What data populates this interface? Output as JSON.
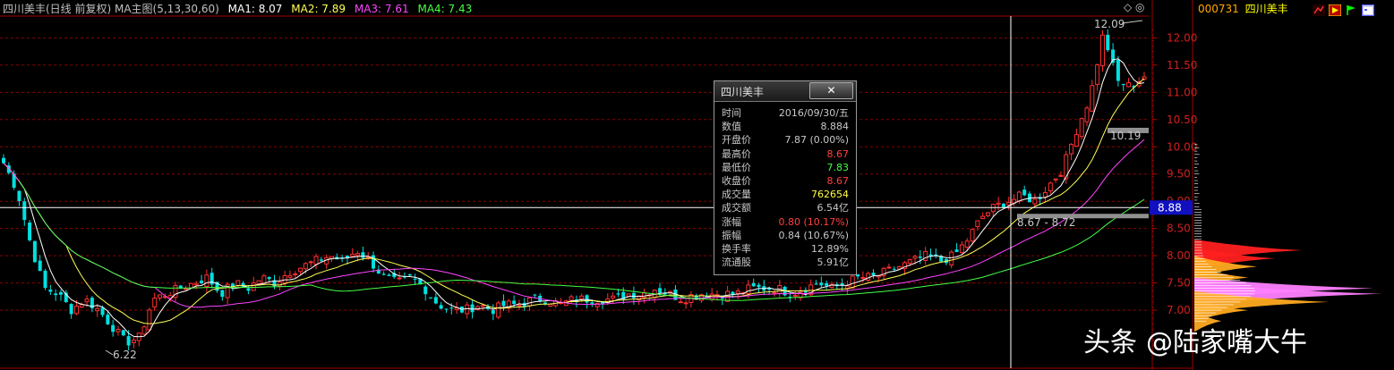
{
  "header": {
    "title": "四川美丰(日线 前复权) MA主图(5,13,30,60)",
    "ma": [
      {
        "label": "MA1: 8.07",
        "color": "#ffffff"
      },
      {
        "label": "MA2: 7.89",
        "color": "#ffff55"
      },
      {
        "label": "MA3: 7.61",
        "color": "#ff44ff"
      },
      {
        "label": "MA4: 7.43",
        "color": "#44ff44"
      }
    ]
  },
  "sidebar": {
    "code": "000731",
    "name": "四川美丰"
  },
  "price_axis": {
    "ticks": [
      "12.00",
      "11.50",
      "11.00",
      "10.50",
      "10.00",
      "9.50",
      "9.00",
      "8.50",
      "8.00",
      "7.50",
      "7.00"
    ],
    "current_label": "8.88"
  },
  "annotations": {
    "high": "12.09",
    "low": "6.22",
    "level_a": "10.19",
    "level_b": "8.67 - 8.72",
    "top_marker": "◇ ◎"
  },
  "popup": {
    "title": "四川美丰",
    "close_label": "✕",
    "rows": [
      {
        "k": "时间",
        "v": "2016/09/30/五",
        "c": "#c8c8c8"
      },
      {
        "k": "数值",
        "v": "8.884",
        "c": "#c8c8c8"
      },
      {
        "k": "开盘价",
        "v": "7.87 (0.00%)",
        "c": "#c8c8c8"
      },
      {
        "k": "最高价",
        "v": "8.67",
        "c": "#ff4040"
      },
      {
        "k": "最低价",
        "v": "7.83",
        "c": "#40ff40"
      },
      {
        "k": "收盘价",
        "v": "8.67",
        "c": "#ff4040"
      },
      {
        "k": "成交量",
        "v": "762654",
        "c": "#ffff40"
      },
      {
        "k": "成交额",
        "v": "6.54亿",
        "c": "#c8c8c8"
      },
      {
        "k": "涨幅",
        "v": "0.80 (10.17%)",
        "c": "#ff4040"
      },
      {
        "k": "振幅",
        "v": "0.84 (10.67%)",
        "c": "#c8c8c8"
      },
      {
        "k": "换手率",
        "v": "12.89%",
        "c": "#c8c8c8"
      },
      {
        "k": "流通股",
        "v": "5.91亿",
        "c": "#c8c8c8"
      }
    ]
  },
  "watermark": {
    "brand": "头条",
    "account": "@陆家嘴大牛"
  },
  "chart_data": {
    "type": "candlestick",
    "ylim": [
      6.0,
      12.4
    ],
    "series": [
      {
        "name": "MA1",
        "color": "#ffffff"
      },
      {
        "name": "MA2",
        "color": "#ffff55"
      },
      {
        "name": "MA3",
        "color": "#ff44ff"
      },
      {
        "name": "MA4",
        "color": "#44ff44"
      }
    ],
    "close_guide": [
      9.7,
      9.2,
      8.2,
      7.4,
      7.3,
      7.0,
      7.2,
      7.0,
      6.7,
      6.4,
      6.5,
      7.2,
      7.3,
      7.4,
      7.5,
      7.6,
      7.3,
      7.5,
      7.4,
      7.6,
      7.5,
      7.7,
      7.8,
      7.9,
      8.0,
      7.9,
      8.1,
      7.9,
      7.6,
      7.5,
      7.6,
      7.4,
      7.1,
      7.0,
      7.0,
      7.1,
      7.0,
      7.1,
      7.1,
      7.2,
      7.2,
      7.1,
      7.2,
      7.2,
      7.2,
      7.2,
      7.3,
      7.3,
      7.4,
      7.3,
      7.2,
      7.3,
      7.3,
      7.3,
      7.3,
      7.4,
      7.4,
      7.4,
      7.3,
      7.4,
      7.5,
      7.4,
      7.5,
      7.6,
      7.6,
      7.7,
      7.8,
      7.9,
      8.0,
      7.9,
      8.0,
      8.3,
      8.7,
      8.9,
      9.0,
      9.1,
      9.0,
      9.3,
      9.6,
      10.3,
      10.9,
      12.09,
      11.2,
      11.1,
      11.3
    ],
    "volume_profile": [
      {
        "price": 8.1,
        "width": 120,
        "color": "#ff2020"
      },
      {
        "price": 7.95,
        "width": 90,
        "color": "#ff2020"
      },
      {
        "price": 7.8,
        "width": 70,
        "color": "#ffaa20"
      },
      {
        "price": 7.6,
        "width": 60,
        "color": "#ffaa20"
      },
      {
        "price": 7.4,
        "width": 200,
        "color": "#ff80ff"
      },
      {
        "price": 7.3,
        "width": 210,
        "color": "#ff80ff"
      },
      {
        "price": 7.15,
        "width": 150,
        "color": "#ffaa20"
      },
      {
        "price": 7.0,
        "width": 60,
        "color": "#ffaa20"
      },
      {
        "price": 6.8,
        "width": 30,
        "color": "#ffaa20"
      }
    ]
  }
}
